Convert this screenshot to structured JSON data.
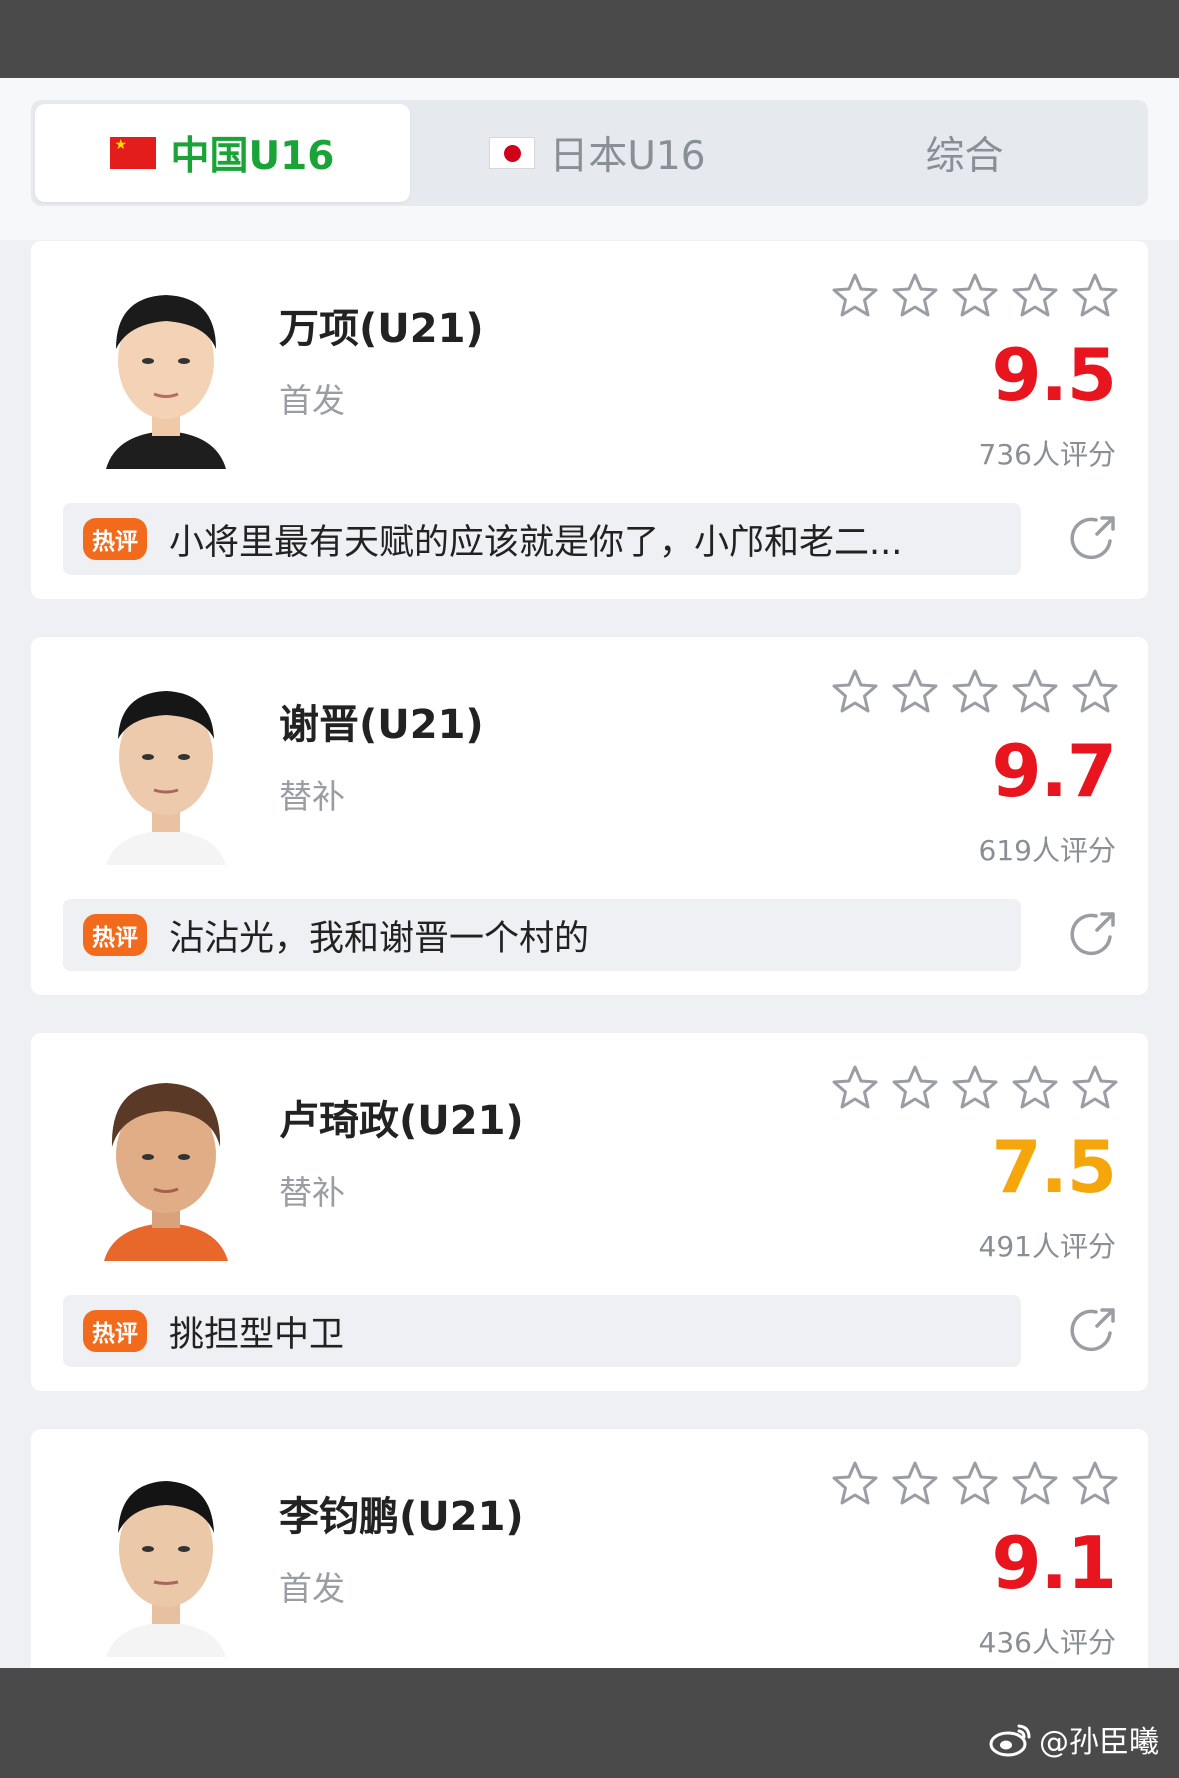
{
  "tabs": [
    {
      "label": "中国U16",
      "flag": "china-flag-icon",
      "active": true
    },
    {
      "label": "日本U16",
      "flag": "japan-flag-icon",
      "active": false
    },
    {
      "label": "综合",
      "active": false
    }
  ],
  "hot_badge_label": "热评",
  "players": [
    {
      "name": "万项(U21)",
      "role": "首发",
      "score": "9.5",
      "score_color": "#e8141e",
      "rating_count": "736人评分",
      "comment": "小将里最有天赋的应该就是你了，小邝和老二...",
      "stars_filled": 0
    },
    {
      "name": "谢晋(U21)",
      "role": "替补",
      "score": "9.7",
      "score_color": "#e8141e",
      "rating_count": "619人评分",
      "comment": "沾沾光，我和谢晋一个村的",
      "stars_filled": 0
    },
    {
      "name": "卢琦政(U21)",
      "role": "替补",
      "score": "7.5",
      "score_color": "#f5a60a",
      "rating_count": "491人评分",
      "comment": "挑担型中卫",
      "stars_filled": 0
    },
    {
      "name": "李钧鹏(U21)",
      "role": "首发",
      "score": "9.1",
      "score_color": "#e8141e",
      "rating_count": "436人评分",
      "stars_filled": 0
    }
  ],
  "watermark": "@孙臣曦",
  "colors": {
    "active_tab": "#1aa336",
    "score_red": "#e8141e",
    "score_orange": "#f5a60a",
    "hot_badge": "#f26a1b"
  }
}
